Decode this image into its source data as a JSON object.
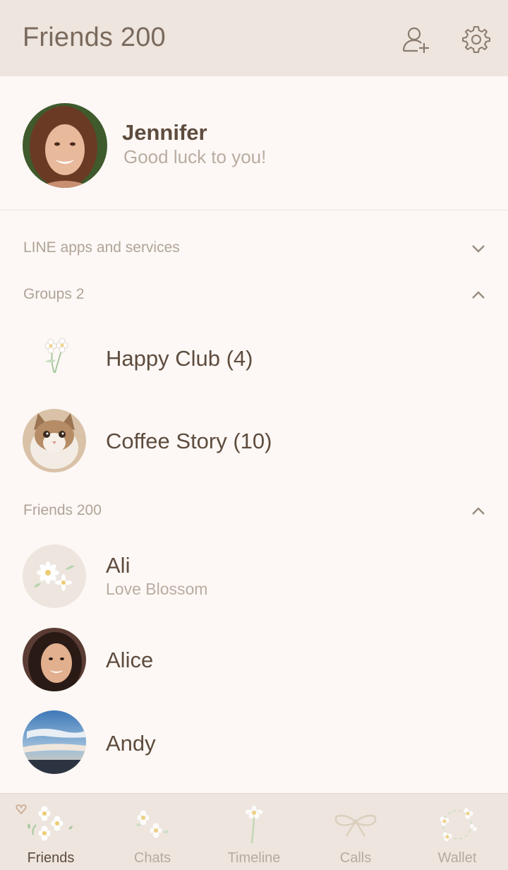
{
  "header": {
    "title": "Friends 200",
    "add_friend_icon": "add-user-icon",
    "settings_icon": "gear-icon"
  },
  "profile": {
    "name": "Jennifer",
    "status": "Good luck to you!"
  },
  "sections": {
    "services": {
      "label": "LINE apps and services",
      "state": "collapsed"
    },
    "groups": {
      "label": "Groups 2",
      "state": "expanded",
      "items": [
        {
          "name": "Happy Club (4)",
          "avatar": "flower-icon"
        },
        {
          "name": "Coffee Story (10)",
          "avatar": "cat-photo"
        }
      ]
    },
    "friends": {
      "label": "Friends 200",
      "state": "expanded",
      "items": [
        {
          "name": "Ali",
          "status": "Love Blossom",
          "avatar": "daisy-icon"
        },
        {
          "name": "Alice",
          "avatar": "woman-photo"
        },
        {
          "name": "Andy",
          "avatar": "sky-photo"
        }
      ]
    }
  },
  "tabs": [
    {
      "label": "Friends",
      "icon": "daisy-bouquet-icon",
      "active": true
    },
    {
      "label": "Chats",
      "icon": "daisy-pair-icon",
      "active": false
    },
    {
      "label": "Timeline",
      "icon": "single-flower-icon",
      "active": false
    },
    {
      "label": "Calls",
      "icon": "ribbon-icon",
      "active": false
    },
    {
      "label": "Wallet",
      "icon": "flower-wreath-icon",
      "active": false
    }
  ],
  "colors": {
    "background": "#fdf8f5",
    "bar": "#ede5de",
    "text": "#5e4c3e",
    "muted": "#b0a398"
  }
}
